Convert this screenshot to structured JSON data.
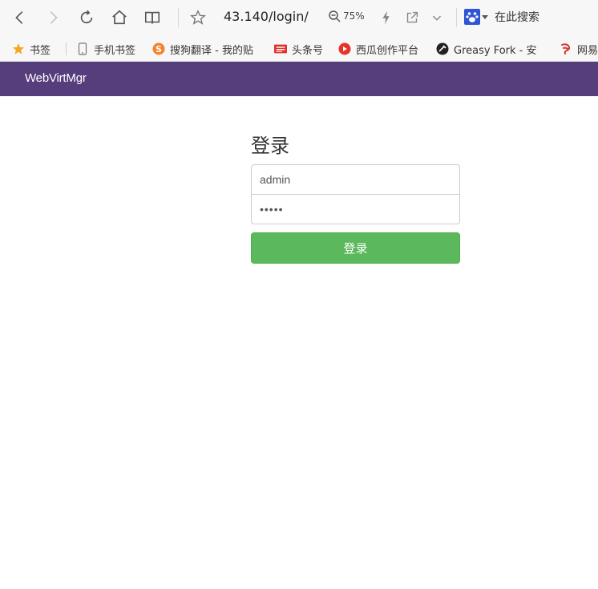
{
  "browser": {
    "url": "43.140/login/",
    "zoom": "75%",
    "search_label": "在此搜索"
  },
  "bookmarks": [
    {
      "label": "书签",
      "icon": "star-icon",
      "color": "#f5a623"
    },
    {
      "label": "手机书签",
      "icon": "phone-icon",
      "color": "#777777"
    },
    {
      "label": "搜狗翻译 - 我的贴",
      "icon": "sogou-icon",
      "color": "#f5822a"
    },
    {
      "label": "头条号",
      "icon": "toutiao-icon",
      "color": "#e2322d"
    },
    {
      "label": "西瓜创作平台",
      "icon": "xigua-icon",
      "color": "#e8332a"
    },
    {
      "label": "Greasy Fork - 安",
      "icon": "greasyfork-icon",
      "color": "#222222"
    },
    {
      "label": "网易",
      "icon": "netease-icon",
      "color": "#d43a2f"
    }
  ],
  "app": {
    "brand": "WebVirtMgr",
    "navbar_color": "#563d7c"
  },
  "login": {
    "title": "登录",
    "username_value": "admin",
    "password_value": "•••••",
    "submit_label": "登录",
    "button_color": "#5cb85c"
  }
}
